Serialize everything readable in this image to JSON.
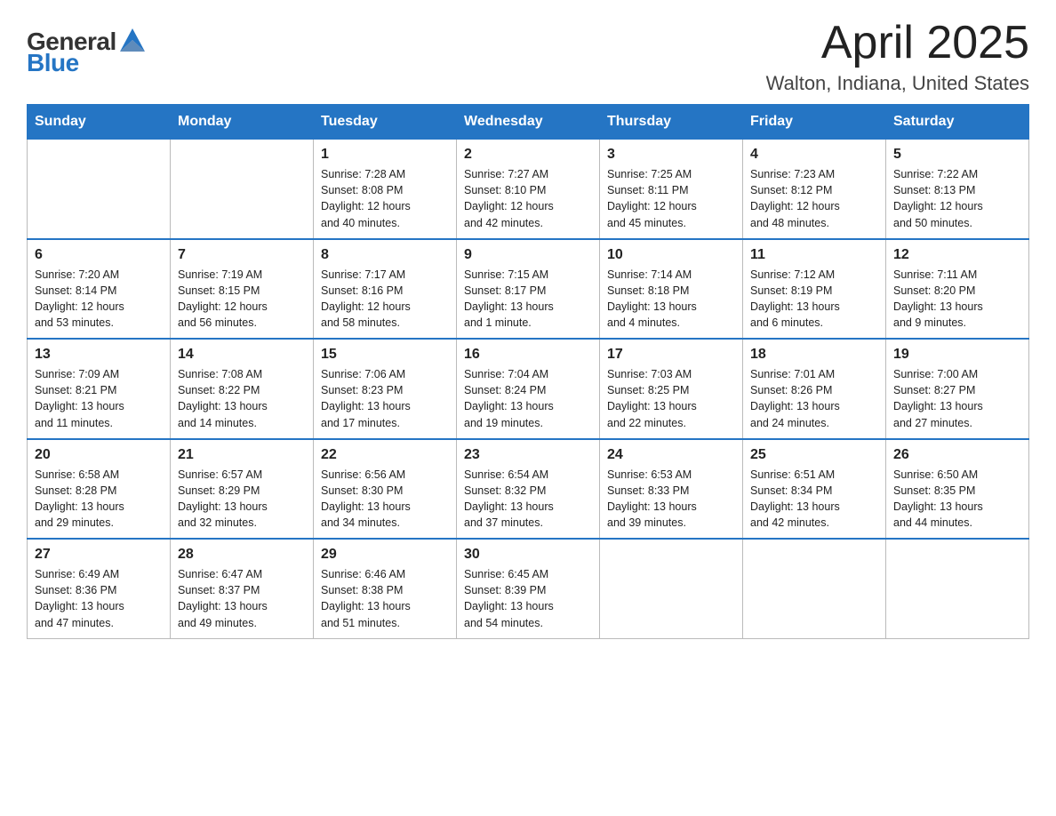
{
  "header": {
    "logo_general": "General",
    "logo_blue": "Blue",
    "title": "April 2025",
    "subtitle": "Walton, Indiana, United States"
  },
  "days_of_week": [
    "Sunday",
    "Monday",
    "Tuesday",
    "Wednesday",
    "Thursday",
    "Friday",
    "Saturday"
  ],
  "weeks": [
    [
      {
        "day": "",
        "info": ""
      },
      {
        "day": "",
        "info": ""
      },
      {
        "day": "1",
        "info": "Sunrise: 7:28 AM\nSunset: 8:08 PM\nDaylight: 12 hours\nand 40 minutes."
      },
      {
        "day": "2",
        "info": "Sunrise: 7:27 AM\nSunset: 8:10 PM\nDaylight: 12 hours\nand 42 minutes."
      },
      {
        "day": "3",
        "info": "Sunrise: 7:25 AM\nSunset: 8:11 PM\nDaylight: 12 hours\nand 45 minutes."
      },
      {
        "day": "4",
        "info": "Sunrise: 7:23 AM\nSunset: 8:12 PM\nDaylight: 12 hours\nand 48 minutes."
      },
      {
        "day": "5",
        "info": "Sunrise: 7:22 AM\nSunset: 8:13 PM\nDaylight: 12 hours\nand 50 minutes."
      }
    ],
    [
      {
        "day": "6",
        "info": "Sunrise: 7:20 AM\nSunset: 8:14 PM\nDaylight: 12 hours\nand 53 minutes."
      },
      {
        "day": "7",
        "info": "Sunrise: 7:19 AM\nSunset: 8:15 PM\nDaylight: 12 hours\nand 56 minutes."
      },
      {
        "day": "8",
        "info": "Sunrise: 7:17 AM\nSunset: 8:16 PM\nDaylight: 12 hours\nand 58 minutes."
      },
      {
        "day": "9",
        "info": "Sunrise: 7:15 AM\nSunset: 8:17 PM\nDaylight: 13 hours\nand 1 minute."
      },
      {
        "day": "10",
        "info": "Sunrise: 7:14 AM\nSunset: 8:18 PM\nDaylight: 13 hours\nand 4 minutes."
      },
      {
        "day": "11",
        "info": "Sunrise: 7:12 AM\nSunset: 8:19 PM\nDaylight: 13 hours\nand 6 minutes."
      },
      {
        "day": "12",
        "info": "Sunrise: 7:11 AM\nSunset: 8:20 PM\nDaylight: 13 hours\nand 9 minutes."
      }
    ],
    [
      {
        "day": "13",
        "info": "Sunrise: 7:09 AM\nSunset: 8:21 PM\nDaylight: 13 hours\nand 11 minutes."
      },
      {
        "day": "14",
        "info": "Sunrise: 7:08 AM\nSunset: 8:22 PM\nDaylight: 13 hours\nand 14 minutes."
      },
      {
        "day": "15",
        "info": "Sunrise: 7:06 AM\nSunset: 8:23 PM\nDaylight: 13 hours\nand 17 minutes."
      },
      {
        "day": "16",
        "info": "Sunrise: 7:04 AM\nSunset: 8:24 PM\nDaylight: 13 hours\nand 19 minutes."
      },
      {
        "day": "17",
        "info": "Sunrise: 7:03 AM\nSunset: 8:25 PM\nDaylight: 13 hours\nand 22 minutes."
      },
      {
        "day": "18",
        "info": "Sunrise: 7:01 AM\nSunset: 8:26 PM\nDaylight: 13 hours\nand 24 minutes."
      },
      {
        "day": "19",
        "info": "Sunrise: 7:00 AM\nSunset: 8:27 PM\nDaylight: 13 hours\nand 27 minutes."
      }
    ],
    [
      {
        "day": "20",
        "info": "Sunrise: 6:58 AM\nSunset: 8:28 PM\nDaylight: 13 hours\nand 29 minutes."
      },
      {
        "day": "21",
        "info": "Sunrise: 6:57 AM\nSunset: 8:29 PM\nDaylight: 13 hours\nand 32 minutes."
      },
      {
        "day": "22",
        "info": "Sunrise: 6:56 AM\nSunset: 8:30 PM\nDaylight: 13 hours\nand 34 minutes."
      },
      {
        "day": "23",
        "info": "Sunrise: 6:54 AM\nSunset: 8:32 PM\nDaylight: 13 hours\nand 37 minutes."
      },
      {
        "day": "24",
        "info": "Sunrise: 6:53 AM\nSunset: 8:33 PM\nDaylight: 13 hours\nand 39 minutes."
      },
      {
        "day": "25",
        "info": "Sunrise: 6:51 AM\nSunset: 8:34 PM\nDaylight: 13 hours\nand 42 minutes."
      },
      {
        "day": "26",
        "info": "Sunrise: 6:50 AM\nSunset: 8:35 PM\nDaylight: 13 hours\nand 44 minutes."
      }
    ],
    [
      {
        "day": "27",
        "info": "Sunrise: 6:49 AM\nSunset: 8:36 PM\nDaylight: 13 hours\nand 47 minutes."
      },
      {
        "day": "28",
        "info": "Sunrise: 6:47 AM\nSunset: 8:37 PM\nDaylight: 13 hours\nand 49 minutes."
      },
      {
        "day": "29",
        "info": "Sunrise: 6:46 AM\nSunset: 8:38 PM\nDaylight: 13 hours\nand 51 minutes."
      },
      {
        "day": "30",
        "info": "Sunrise: 6:45 AM\nSunset: 8:39 PM\nDaylight: 13 hours\nand 54 minutes."
      },
      {
        "day": "",
        "info": ""
      },
      {
        "day": "",
        "info": ""
      },
      {
        "day": "",
        "info": ""
      }
    ]
  ]
}
